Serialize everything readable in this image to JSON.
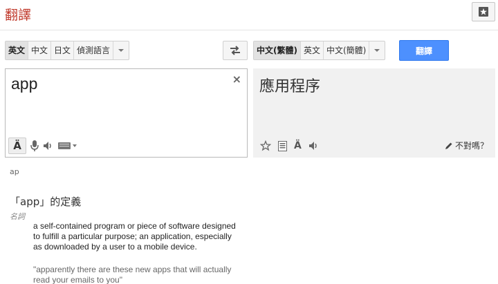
{
  "header": {
    "logo": "翻譯",
    "star_icon": "star-icon"
  },
  "source_langs": {
    "items": [
      {
        "label": "英文",
        "active": true
      },
      {
        "label": "中文",
        "active": false
      },
      {
        "label": "日文",
        "active": false
      },
      {
        "label": "偵測語言",
        "active": false
      }
    ]
  },
  "target_langs": {
    "items": [
      {
        "label": "中文(繁體)",
        "active": true
      },
      {
        "label": "英文",
        "active": false
      },
      {
        "label": "中文(簡體)",
        "active": false
      }
    ]
  },
  "translate_button": "翻譯",
  "source": {
    "text": "app",
    "clear": "×"
  },
  "target": {
    "text": "應用程序",
    "wrong_label": "不對嗎？"
  },
  "dictionary": {
    "romanization": "ap",
    "title": "「app」的定義",
    "pos": "名詞",
    "definition": "a self-contained program or piece of software designed to fulfill a particular purpose; an application, especially as downloaded by a user to a mobile device.",
    "example": "\"apparently there are these new apps that will actually read your emails to you\""
  },
  "colors": {
    "accent": "#4d90fe",
    "logo": "#c0392b"
  }
}
